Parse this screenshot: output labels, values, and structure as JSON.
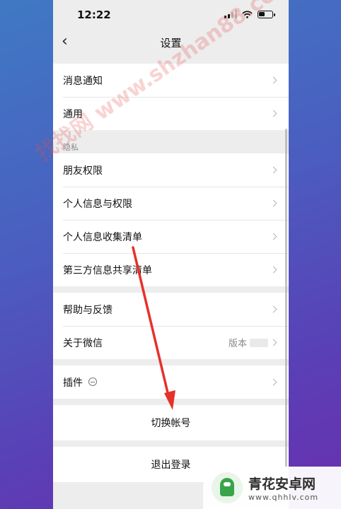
{
  "status": {
    "time": "12:22"
  },
  "nav": {
    "title": "设置"
  },
  "groups": {
    "top": [
      {
        "label": "消息通知"
      },
      {
        "label": "通用"
      }
    ],
    "privacy_label": "隐私",
    "privacy": [
      {
        "label": "朋友权限"
      },
      {
        "label": "个人信息与权限"
      },
      {
        "label": "个人信息收集清单"
      },
      {
        "label": "第三方信息共享清单"
      }
    ],
    "help": [
      {
        "label": "帮助与反馈"
      },
      {
        "label": "关于微信",
        "value": "版本"
      }
    ],
    "plugin": {
      "label": "插件"
    }
  },
  "actions": {
    "switch_account": "切换帐号",
    "logout": "退出登录"
  },
  "overlay": {
    "watermark": "找找网 www.shzhan88.com",
    "badge_name": "青花安卓网",
    "badge_url": "www.qhhlv.com",
    "arrow_color": "#e8302a"
  }
}
